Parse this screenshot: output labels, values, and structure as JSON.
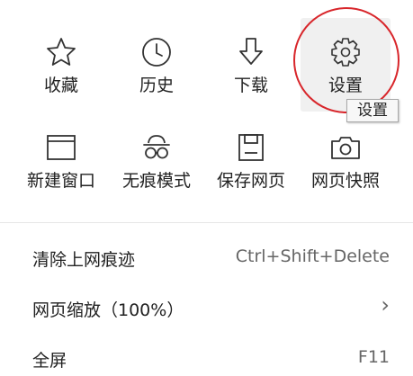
{
  "toolbar": {
    "favorites": {
      "label": "收藏",
      "icon": "star-icon"
    },
    "history": {
      "label": "历史",
      "icon": "clock-icon"
    },
    "download": {
      "label": "下载",
      "icon": "download-icon"
    },
    "settings": {
      "label": "设置",
      "icon": "gear-icon",
      "tooltip": "设置"
    },
    "new_window": {
      "label": "新建窗口",
      "icon": "window-icon"
    },
    "incognito": {
      "label": "无痕模式",
      "icon": "incognito-icon"
    },
    "save_page": {
      "label": "保存网页",
      "icon": "save-icon"
    },
    "screenshot": {
      "label": "网页快照",
      "icon": "camera-icon"
    }
  },
  "menu": {
    "clear_history": {
      "label": "清除上网痕迹",
      "shortcut": "Ctrl+Shift+Delete"
    },
    "zoom": {
      "label": "网页缩放（100%）",
      "arrow": "›"
    },
    "fullscreen": {
      "label": "全屏",
      "shortcut": "F11"
    }
  },
  "colors": {
    "highlight_ring": "#d8262b",
    "hover_bg": "#f0f0f0"
  }
}
